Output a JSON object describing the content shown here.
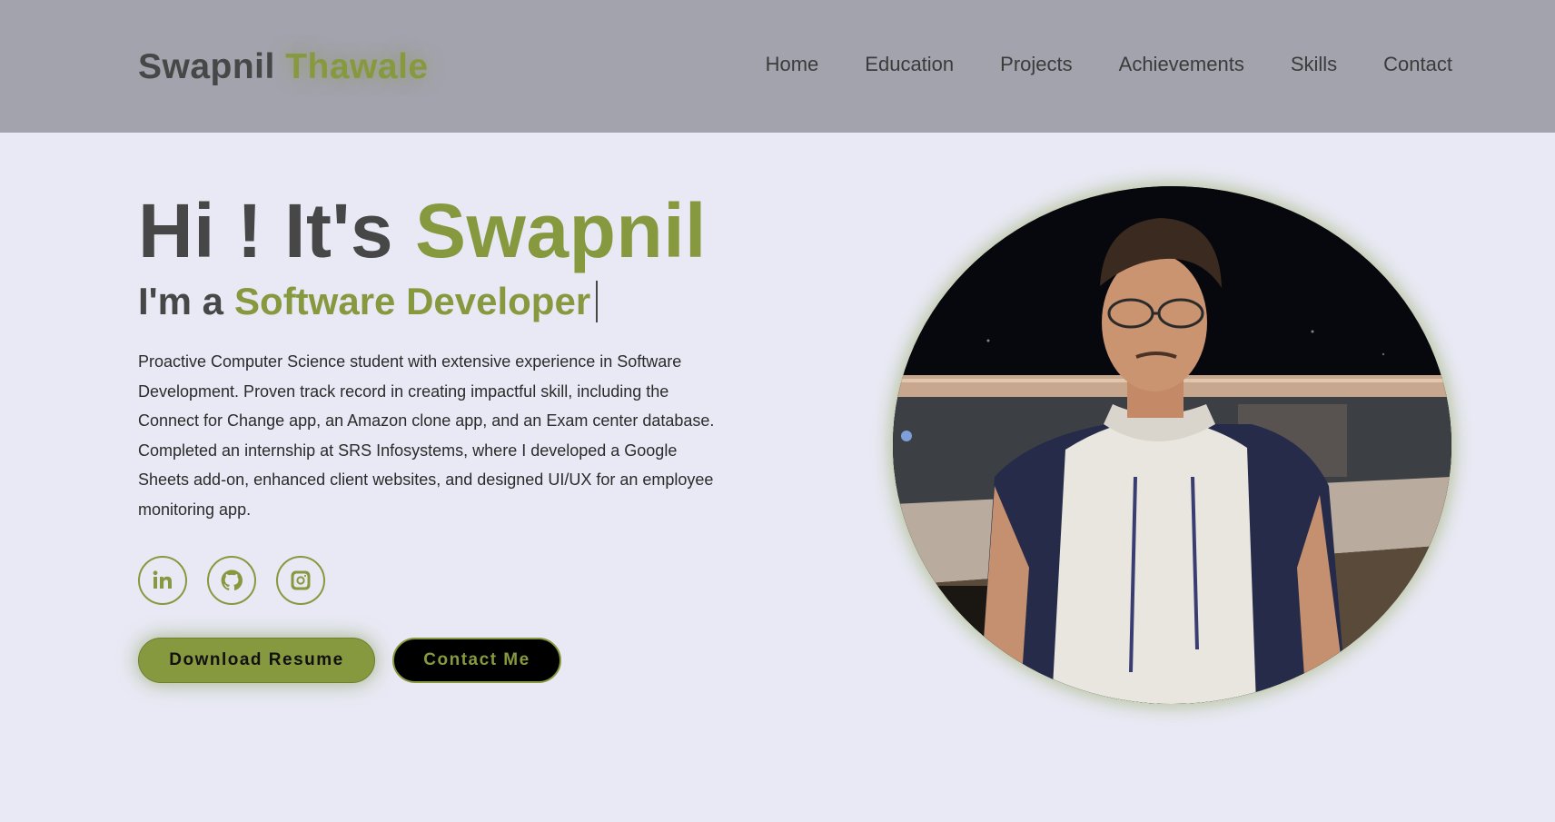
{
  "header": {
    "logo_first": "Swapnil",
    "logo_last": "Thawale",
    "nav": [
      "Home",
      "Education",
      "Projects",
      "Achievements",
      "Skills",
      "Contact"
    ]
  },
  "hero": {
    "greeting": "Hi ! It's",
    "name": "Swapnil",
    "role_prefix": "I'm a",
    "role": "Software Developer",
    "about": "Proactive Computer Science student with extensive experience in Software Development. Proven track record in creating impactful skill, including the Connect for Change app, an Amazon clone app, and an Exam center database. Completed an internship at SRS Infosystems, where I developed a Google Sheets add-on, enhanced client websites, and designed UI/UX for an employee monitoring app.",
    "socials": [
      {
        "icon": "linkedin-icon"
      },
      {
        "icon": "github-icon"
      },
      {
        "icon": "instagram-icon"
      }
    ],
    "download_label": "Download Resume",
    "contact_label": "Contact Me"
  },
  "colors": {
    "accent": "#86993f",
    "header_bg": "#a3a3ad",
    "page_bg": "#e8e9f4",
    "text_dark": "#474747"
  }
}
